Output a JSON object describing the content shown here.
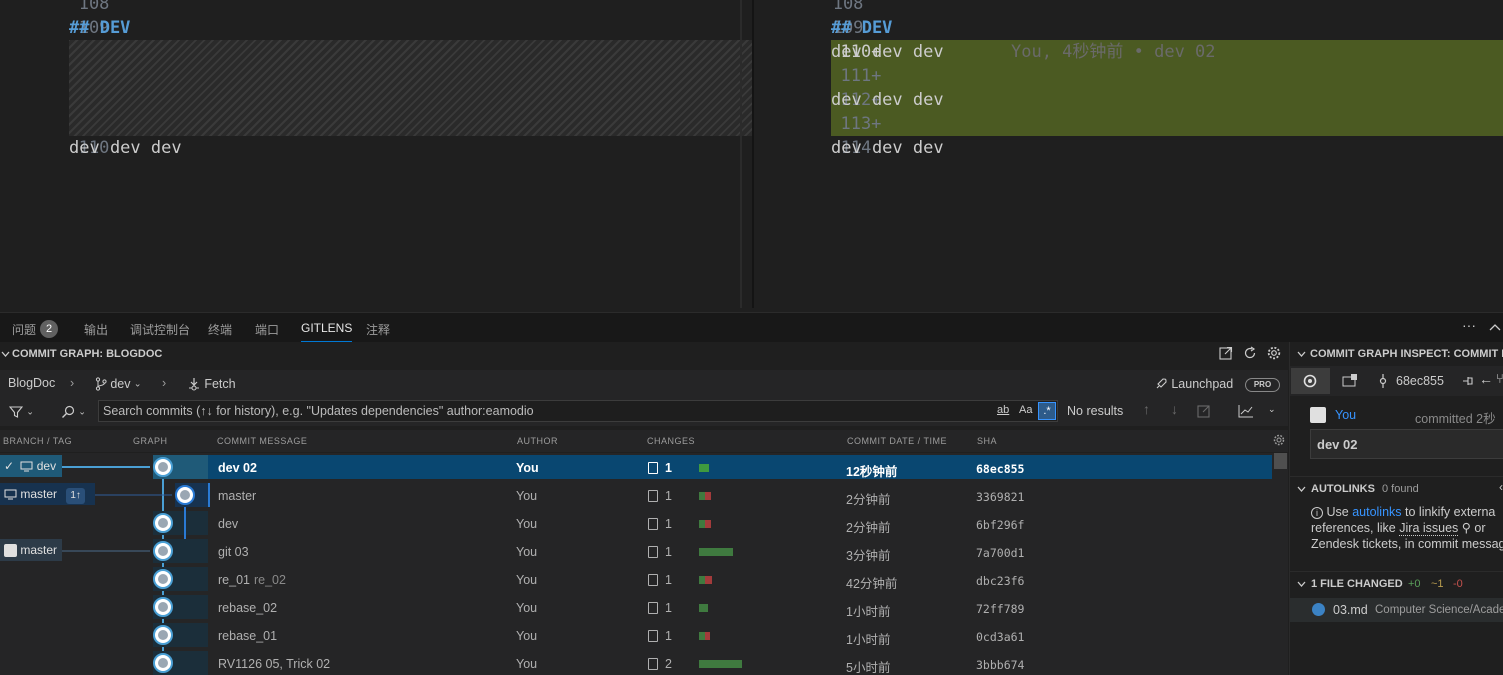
{
  "editor": {
    "left": {
      "lines": [
        {
          "num": "108",
          "text": ""
        },
        {
          "num": "109",
          "text": "## DEV"
        },
        {
          "num": "110",
          "text": "dev dev dev"
        }
      ]
    },
    "right": {
      "lines": [
        {
          "num": "108",
          "text": ""
        },
        {
          "num": "109",
          "text": "## DEV"
        },
        {
          "num": "110+",
          "text": "dev dev dev"
        },
        {
          "num": "111+",
          "text": ""
        },
        {
          "num": "112+",
          "text": "dev dev dev"
        },
        {
          "num": "113+",
          "text": ""
        },
        {
          "num": "114",
          "text": "dev dev dev"
        }
      ],
      "blame": "You, 4秒钟前 • dev 02"
    }
  },
  "panel_tabs": {
    "problems": "问题",
    "problems_count": "2",
    "output": "输出",
    "debug_console": "调试控制台",
    "terminal": "终端",
    "ports": "端口",
    "gitlens": "GITLENS",
    "comments": "注释",
    "more": "···",
    "collapse": "^"
  },
  "graph": {
    "title": "COMMIT GRAPH: BLOGDOC",
    "repo": "BlogDoc",
    "branch": "dev",
    "fetch": "Fetch",
    "launchpad": "Launchpad",
    "pro": "PRO",
    "search_placeholder": "Search commits (↑↓ for history), e.g. \"Updates dependencies\" author:eamodio",
    "match_word": "ab",
    "match_case": "Aa",
    "results": "No results",
    "columns": {
      "branch": "BRANCH / TAG",
      "graph": "GRAPH",
      "message": "COMMIT MESSAGE",
      "author": "AUTHOR",
      "changes": "CHANGES",
      "date": "COMMIT DATE / TIME",
      "sha": "SHA"
    },
    "refs": {
      "dev": "dev",
      "master_local": "master",
      "master_ahead": "1↑",
      "master_remote": "master"
    },
    "commits": [
      {
        "message": "dev 02",
        "sub": "",
        "author": "You",
        "files": "1",
        "date": "12秒钟前",
        "sha": "68ec855"
      },
      {
        "message": "master",
        "sub": "",
        "author": "You",
        "files": "1",
        "date": "2分钟前",
        "sha": "3369821"
      },
      {
        "message": "dev",
        "sub": "",
        "author": "You",
        "files": "1",
        "date": "2分钟前",
        "sha": "6bf296f"
      },
      {
        "message": "git 03",
        "sub": "",
        "author": "You",
        "files": "1",
        "date": "3分钟前",
        "sha": "7a700d1"
      },
      {
        "message": "re_01",
        "sub": "re_02",
        "author": "You",
        "files": "1",
        "date": "42分钟前",
        "sha": "dbc23f6"
      },
      {
        "message": "rebase_02",
        "sub": "",
        "author": "You",
        "files": "1",
        "date": "1小时前",
        "sha": "72ff789"
      },
      {
        "message": "rebase_01",
        "sub": "",
        "author": "You",
        "files": "1",
        "date": "1小时前",
        "sha": "0cd3a61"
      },
      {
        "message": "RV1126 05, Trick 02",
        "sub": "",
        "author": "You",
        "files": "2",
        "date": "5小时前",
        "sha": "3bbb674"
      }
    ]
  },
  "inspect": {
    "title": "COMMIT GRAPH INSPECT: COMMIT D",
    "sha": "68ec855",
    "author": "You",
    "committed": "committed 2秒",
    "message": "dev 02",
    "autolinks_title": "AUTOLINKS",
    "autolinks_count": "0 found",
    "autolinks_use": "Use",
    "autolinks_link": "autolinks",
    "autolinks_rest1": "to linkify externa",
    "autolinks_line2a": "references, like",
    "autolinks_jira": "Jira issues",
    "autolinks_or": "or",
    "autolinks_line3": "Zendesk tickets, in commit messag",
    "files_title": "1 FILE CHANGED",
    "files_added": "+0",
    "files_modified": "~1",
    "files_deleted": "-0",
    "file_name": "03.md",
    "file_path": "Computer Science/Acade"
  },
  "colors": {
    "accent": "#0078d4",
    "added": "#4b5a22",
    "selected_row": "#094771",
    "graph_line": "#4a9fd4",
    "bar_green": "#3f7a3f",
    "bar_red": "#a33b3b"
  }
}
